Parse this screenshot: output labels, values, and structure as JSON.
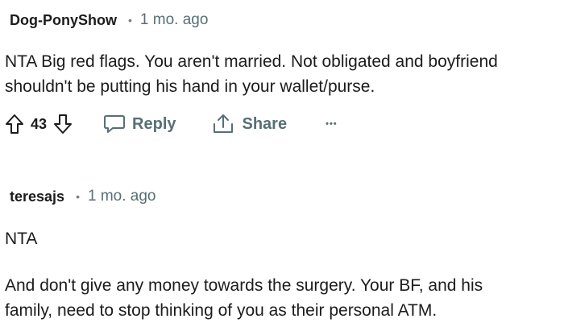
{
  "comments": [
    {
      "author": "Dog-PonyShow",
      "separator": "•",
      "time": "1 mo. ago",
      "lines": [
        "NTA Big red flags. You aren't married. Not obligated and boyfriend",
        "shouldn't be putting his hand in your wallet/purse."
      ],
      "votes": "43",
      "reply_label": "Reply",
      "share_label": "Share",
      "more_label": "•••"
    },
    {
      "author": "teresajs",
      "separator": "•",
      "time": "1 mo. ago",
      "paragraphs": [
        "NTA",
        "And don't give any money towards the surgery. Your BF, and his",
        "family, need to stop thinking of you as their personal ATM."
      ]
    }
  ],
  "colors": {
    "text": "#1c1c1c",
    "meta": "#576f76",
    "icon": "#1c1c1c"
  },
  "icons": [
    "upvote-icon",
    "downvote-icon",
    "reply-icon",
    "share-icon",
    "more-icon"
  ]
}
